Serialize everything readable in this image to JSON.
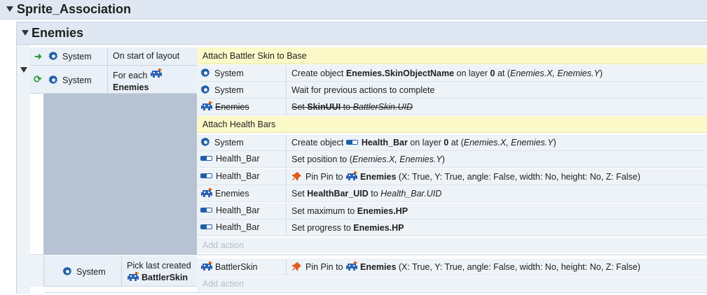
{
  "group": {
    "title": "Sprite_Association"
  },
  "subgroup": {
    "title": "Enemies"
  },
  "event1": {
    "cond1": {
      "object": "System",
      "text": "On start of layout"
    },
    "cond2": {
      "object": "System",
      "text_prefix": "For each",
      "text_object": "Enemies"
    },
    "comment1": "Attach Battler Skin to Base",
    "actions_a": [
      {
        "object": "System",
        "p1": "Create object ",
        "b1": "Enemies.SkinObjectName",
        "p2": " on layer ",
        "b2": "0",
        "p3": " at (",
        "i1": "Enemies.X, Enemies.Y",
        "p4": ")"
      },
      {
        "object": "System",
        "p1": "Wait for previous actions to complete"
      },
      {
        "object": "Enemies",
        "p1": "Set ",
        "b1": "SkinUUI",
        "p2": " to ",
        "i1": "BattlerSkin.UID"
      }
    ],
    "comment2": "Attach Health Bars",
    "actions_b": [
      {
        "object": "System",
        "p1": "Create object ",
        "b1": "Health_Bar",
        "p2": " on layer ",
        "b2": "0",
        "p3": " at (",
        "i1": "Enemies.X, Enemies.Y",
        "p4": ")"
      },
      {
        "object": "Health_Bar",
        "p1": "Set position to (",
        "i1": "Enemies.X, Enemies.Y",
        "p2": ")"
      },
      {
        "object": "Health_Bar",
        "pin_label": "Pin Pin to",
        "target": "Enemies",
        "params": " (X: True, Y: True, angle: False, width: No, height: No, Z: False)"
      },
      {
        "object": "Enemies",
        "p1": "Set ",
        "b1": "HealthBar_UID",
        "p2": " to ",
        "i1": "Health_Bar.UID"
      },
      {
        "object": "Health_Bar",
        "p1": "Set maximum to ",
        "b1": "Enemies.HP"
      },
      {
        "object": "Health_Bar",
        "p1": "Set progress to ",
        "b1": "Enemies.HP"
      }
    ],
    "add_action": "Add action"
  },
  "event2": {
    "cond": {
      "object": "System",
      "text_prefix": "Pick last created",
      "text_object": "BattlerSkin"
    },
    "action": {
      "object": "BattlerSkin",
      "pin_label": "Pin Pin to",
      "target": "Enemies",
      "params": " (X: True, Y: True, angle: False, width: No, height: No, Z: False)"
    },
    "add_action": "Add action"
  },
  "colors": {
    "header_bg": "#dfe8f2",
    "row_bg": "#eef3f8",
    "comment_bg": "#fcf9c8",
    "block_gray": "#b7c3d2",
    "accent_blue": "#1f5fa8",
    "green_arrow": "#2a9d3a",
    "pin_orange": "#e25a1c"
  }
}
